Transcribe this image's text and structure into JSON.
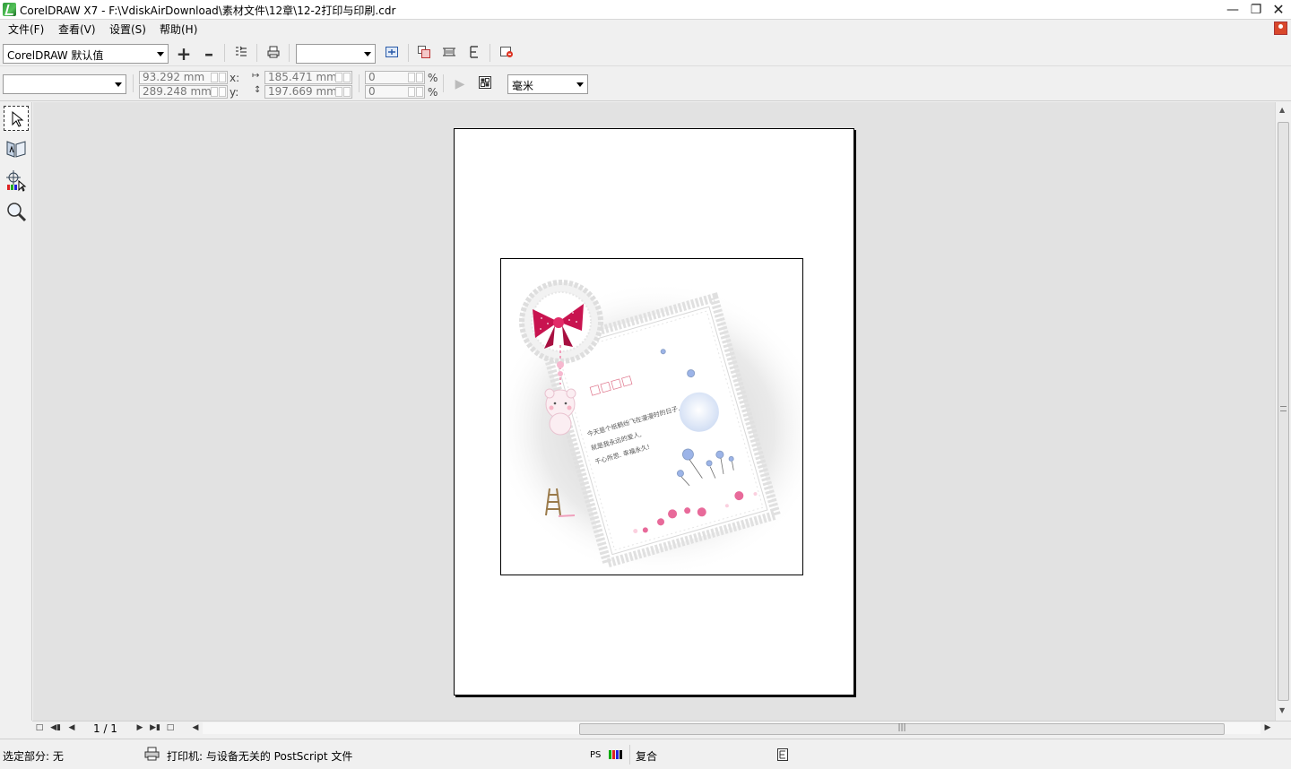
{
  "window": {
    "title": "CorelDRAW X7 - F:\\VdiskAirDownload\\素材文件\\12章\\12-2打印与印刷.cdr",
    "minimize_icon": "minimize-icon",
    "restore_icon": "restore-icon",
    "close_icon": "close-icon"
  },
  "menu": {
    "items": [
      "文件(F)",
      "查看(V)",
      "设置(S)",
      "帮助(H)"
    ]
  },
  "toolbar": {
    "preset_value": "CorelDRAW 默认值",
    "add_preset_icon": "plus-icon",
    "remove_preset_icon": "minus-icon",
    "print_options_icon": "print-options-icon",
    "print_icon": "printer-icon",
    "zoom_select_value": "",
    "icons": [
      "fit-page-icon",
      "tile-icon",
      "ruler-icon",
      "text-icon",
      "close-preview-icon"
    ]
  },
  "property_bar": {
    "position_select_value": "",
    "x_value": "93.292 mm",
    "y_value": "289.248 mm",
    "x_label": "x:",
    "y_label": "y:",
    "width_value": "185.471 mm",
    "height_value": "197.669 mm",
    "scale_x_value": "0",
    "scale_y_value": "0",
    "percent_label": "%",
    "unit_value": "毫米"
  },
  "toolbox": [
    "pick-tool-icon",
    "imposition-tool-icon",
    "marks-placement-tool-icon",
    "zoom-tool-icon"
  ],
  "document": {
    "postcard_title_boxes": "□□□□",
    "postcard_lines": [
      "今天是个纸鹤纷飞在漫漫时的日子.",
      "就是我永远的爱人,",
      "千心所思. 幸福永久!"
    ]
  },
  "navigation": {
    "page_counter": "1 / 1"
  },
  "status": {
    "selection": "选定部分: 无",
    "printer": "打印机: 与设备无关的 PostScript 文件",
    "color_mode": "复合"
  },
  "colors": {
    "bow": "#c8134f",
    "bow_dots": "#ffffff",
    "lace": "#ececec",
    "dandelion": "#9cb4e8",
    "flower": "#e86a9a",
    "ladder": "#9a7a4a"
  }
}
